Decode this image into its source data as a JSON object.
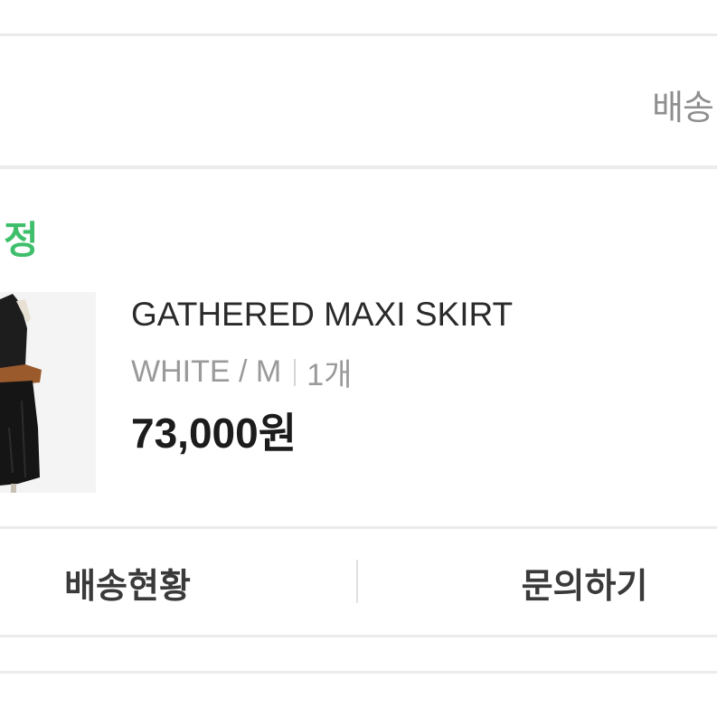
{
  "header": {
    "partial_label": "배송"
  },
  "order": {
    "status_partial": "·정",
    "status_color": "#3fbf6b"
  },
  "product": {
    "name": "GATHERED MAXI SKIRT",
    "option": "WHITE / M",
    "quantity": "1개",
    "price": "73,000원"
  },
  "actions": {
    "shipping_status": "배송현황",
    "inquiry": "문의하기"
  }
}
